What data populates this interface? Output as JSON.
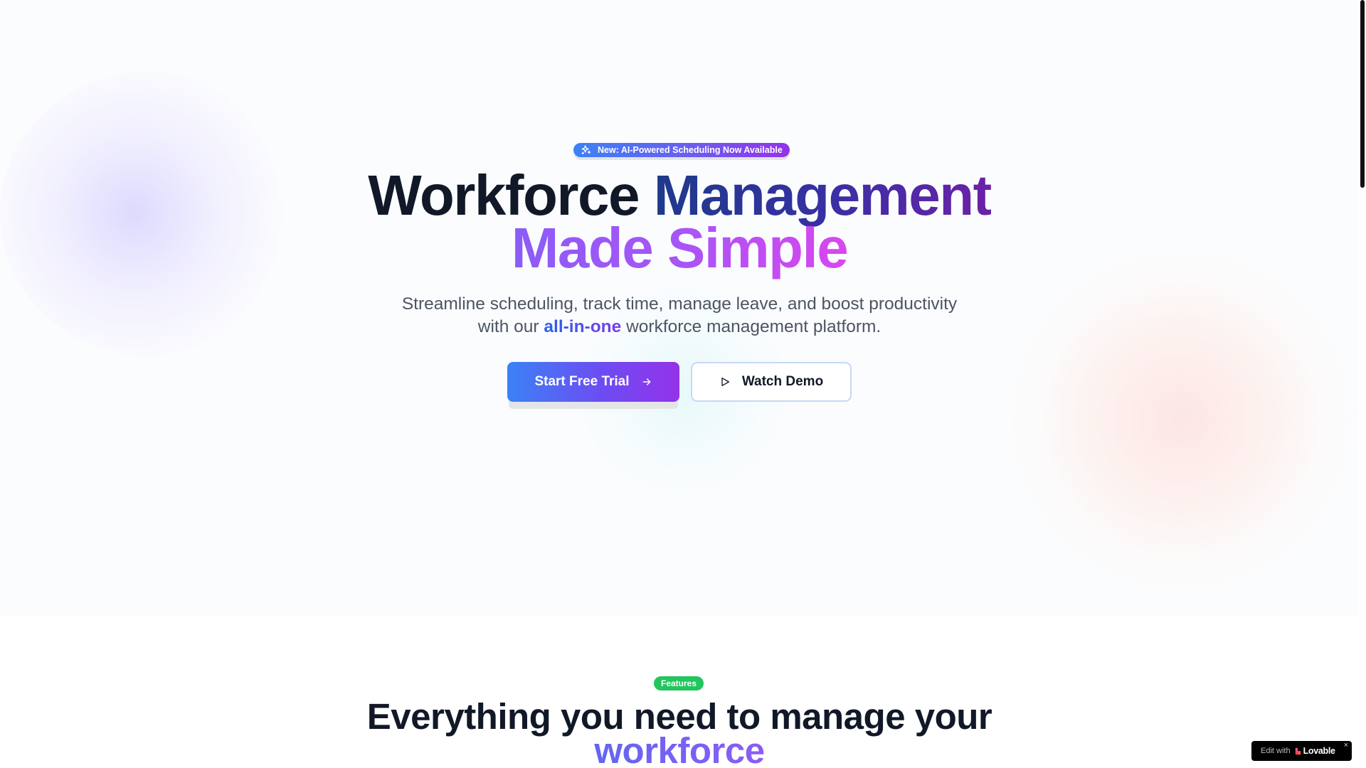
{
  "hero": {
    "badge_label": "New: AI-Powered Scheduling Now Available",
    "title_line1_part1": "Workforce",
    "title_line1_part2": "Management",
    "title_line2": "Made Simple",
    "subtitle_before": "Streamline scheduling, track time, manage leave, and boost productivity with our",
    "subtitle_highlight": "all-in-one",
    "subtitle_after": "workforce management platform.",
    "primary_button_label": "Start Free Trial",
    "secondary_button_label": "Watch Demo"
  },
  "features": {
    "badge_label": "Features",
    "title_part1": "Everything you need to manage your",
    "title_accent": "workforce"
  },
  "lovable_widget": {
    "edit_with": "Edit with",
    "brand": "Lovable",
    "close_glyph": "×"
  },
  "icons": {
    "badge_icon": "sparkles-icon",
    "primary_button_icon": "arrow-right-icon",
    "secondary_button_icon": "play-icon",
    "lovable_icon": "lovable-heart-icon"
  },
  "colors": {
    "accent_blue": "#3b82f6",
    "accent_purple": "#9333ea",
    "features_badge_green": "#22c55e",
    "heading_dark": "#111827"
  }
}
